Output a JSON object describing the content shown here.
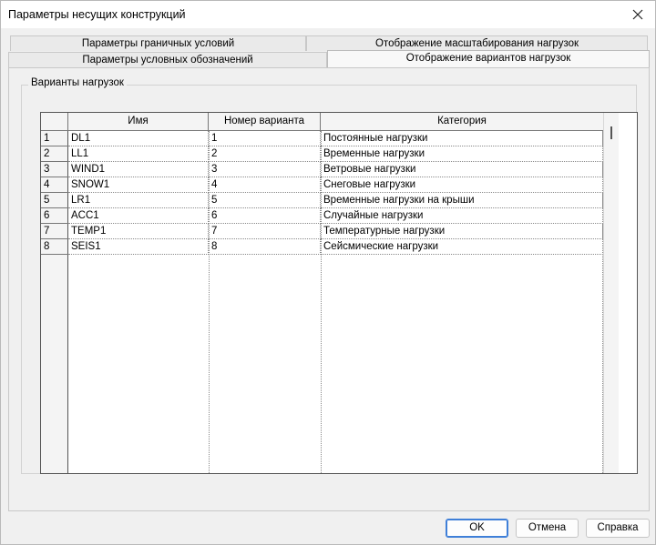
{
  "window": {
    "title": "Параметры несущих конструкций"
  },
  "tabs": {
    "row1": [
      "Параметры граничных условий",
      "Отображение масштабирования нагрузок"
    ],
    "row2": [
      "Параметры условных обозначений",
      "Отображение вариантов нагрузок"
    ],
    "active": "Отображение вариантов нагрузок"
  },
  "group": {
    "label": "Варианты нагрузок"
  },
  "table": {
    "columns": [
      "Имя",
      "Номер варианта",
      "Категория"
    ],
    "rows": [
      {
        "n": "1",
        "name": "DL1",
        "num": "1",
        "category": "Постоянные нагрузки"
      },
      {
        "n": "2",
        "name": "LL1",
        "num": "2",
        "category": "Временные нагрузки"
      },
      {
        "n": "3",
        "name": "WIND1",
        "num": "3",
        "category": "Ветровые нагрузки"
      },
      {
        "n": "4",
        "name": "SNOW1",
        "num": "4",
        "category": "Снеговые нагрузки"
      },
      {
        "n": "5",
        "name": "LR1",
        "num": "5",
        "category": "Временные нагрузки на крыши"
      },
      {
        "n": "6",
        "name": "ACC1",
        "num": "6",
        "category": "Случайные нагрузки"
      },
      {
        "n": "7",
        "name": "TEMP1",
        "num": "7",
        "category": "Температурные нагрузки"
      },
      {
        "n": "8",
        "name": "SEIS1",
        "num": "8",
        "category": "Сейсмические нагрузки"
      }
    ]
  },
  "buttons": {
    "ok": "OK",
    "cancel": "Отмена",
    "help": "Справка"
  }
}
